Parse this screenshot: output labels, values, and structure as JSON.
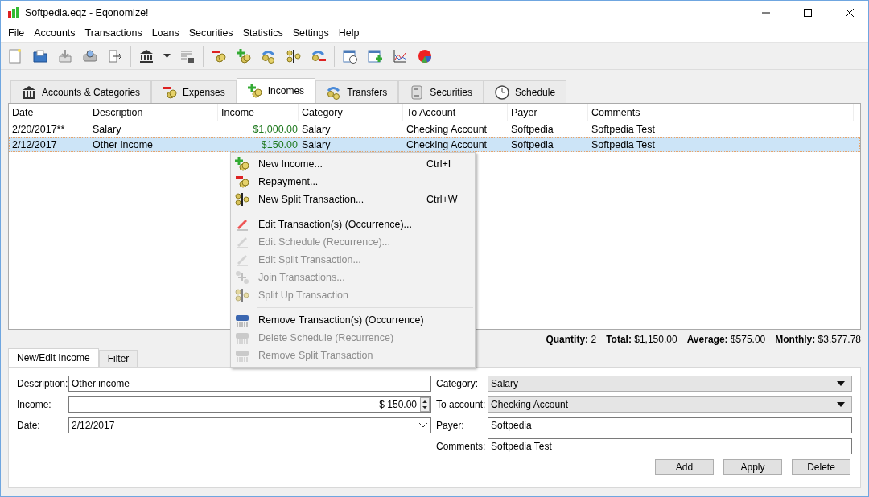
{
  "window": {
    "title": "Softpedia.eqz - Eqonomize!"
  },
  "menu_bar": [
    "File",
    "Accounts",
    "Transactions",
    "Loans",
    "Securities",
    "Statistics",
    "Settings",
    "Help"
  ],
  "tabs": [
    {
      "label": "Accounts & Categories",
      "selected": false
    },
    {
      "label": "Expenses",
      "selected": false
    },
    {
      "label": "Incomes",
      "selected": true
    },
    {
      "label": "Transfers",
      "selected": false
    },
    {
      "label": "Securities",
      "selected": false
    },
    {
      "label": "Schedule",
      "selected": false
    }
  ],
  "table": {
    "columns": [
      "Date",
      "Description",
      "Income",
      "Category",
      "To Account",
      "Payer",
      "Comments"
    ],
    "rows": [
      {
        "cells": [
          "2/20/2017**",
          "Salary",
          "$1,000.00",
          "Salary",
          "Checking Account",
          "Softpedia",
          "Softpedia Test"
        ],
        "selected": false
      },
      {
        "cells": [
          "2/12/2017",
          "Other income",
          "$150.00",
          "Salary",
          "Checking Account",
          "Softpedia",
          "Softpedia Test"
        ],
        "selected": true
      }
    ]
  },
  "context_menu": [
    {
      "kind": "item",
      "label": "New Income...",
      "shortcut": "Ctrl+I",
      "disabled": false
    },
    {
      "kind": "item",
      "label": "Repayment...",
      "disabled": false
    },
    {
      "kind": "item",
      "label": "New Split Transaction...",
      "shortcut": "Ctrl+W",
      "disabled": false
    },
    {
      "kind": "separator"
    },
    {
      "kind": "item",
      "label": "Edit Transaction(s) (Occurrence)...",
      "disabled": false
    },
    {
      "kind": "item",
      "label": "Edit Schedule (Recurrence)...",
      "disabled": true
    },
    {
      "kind": "item",
      "label": "Edit Split Transaction...",
      "disabled": true
    },
    {
      "kind": "item",
      "label": "Join Transactions...",
      "disabled": true
    },
    {
      "kind": "item",
      "label": "Split Up Transaction",
      "disabled": true
    },
    {
      "kind": "separator"
    },
    {
      "kind": "item",
      "label": "Remove Transaction(s) (Occurrence)",
      "disabled": false
    },
    {
      "kind": "item",
      "label": "Delete Schedule (Recurrence)",
      "disabled": true
    },
    {
      "kind": "item",
      "label": "Remove Split Transaction",
      "disabled": true
    }
  ],
  "summary": [
    {
      "label": "Quantity:",
      "value": "2"
    },
    {
      "label": "Total:",
      "value": "$1,150.00"
    },
    {
      "label": "Average:",
      "value": "$575.00"
    },
    {
      "label": "Monthly:",
      "value": "$3,577.78"
    }
  ],
  "editor_tabs": [
    {
      "label": "New/Edit Income",
      "selected": true
    },
    {
      "label": "Filter",
      "selected": false
    }
  ],
  "form_left": [
    {
      "kind": "text",
      "label": "Description:",
      "value": "Other income"
    },
    {
      "kind": "spin",
      "label": "Income:",
      "value": "$ 150.00"
    },
    {
      "kind": "date",
      "label": "Date:",
      "value": "2/12/2017"
    }
  ],
  "form_right": [
    {
      "kind": "combo",
      "label": "Category:",
      "value": "Salary"
    },
    {
      "kind": "combo",
      "label": "To account:",
      "value": "Checking Account"
    },
    {
      "kind": "text",
      "label": "Payer:",
      "value": "Softpedia"
    },
    {
      "kind": "text",
      "label": "Comments:",
      "value": "Softpedia Test"
    }
  ],
  "buttons": [
    "Add",
    "Apply",
    "Delete"
  ]
}
